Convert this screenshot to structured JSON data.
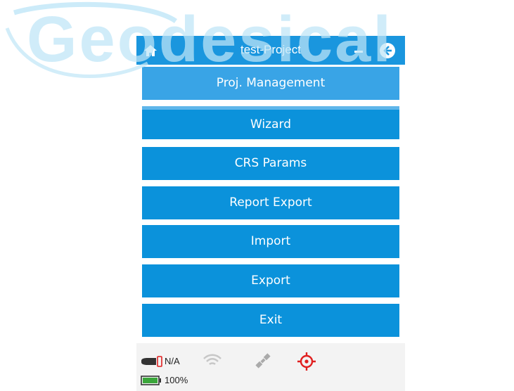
{
  "watermark": {
    "text": "Geodesical"
  },
  "app": {
    "title": "test-Project",
    "menu": [
      {
        "label": "Proj. Management",
        "selected": true
      },
      {
        "label": "Wizard",
        "selected": false
      },
      {
        "label": "CRS Params",
        "selected": false
      },
      {
        "label": "Report Export",
        "selected": false
      },
      {
        "label": "Import",
        "selected": false
      },
      {
        "label": "Export",
        "selected": false
      },
      {
        "label": "Exit",
        "selected": false
      }
    ]
  },
  "status": {
    "receiver_battery": "N/A",
    "device_battery": "100%",
    "icons": [
      "receiver-icon",
      "wifi-icon",
      "satellite-icon",
      "gps-target-icon",
      "battery-icon"
    ]
  },
  "colors": {
    "titlebar": "#1a96de",
    "button": "#0b92db",
    "button_selected": "#39a4e6",
    "status_alert": "#e02020"
  }
}
